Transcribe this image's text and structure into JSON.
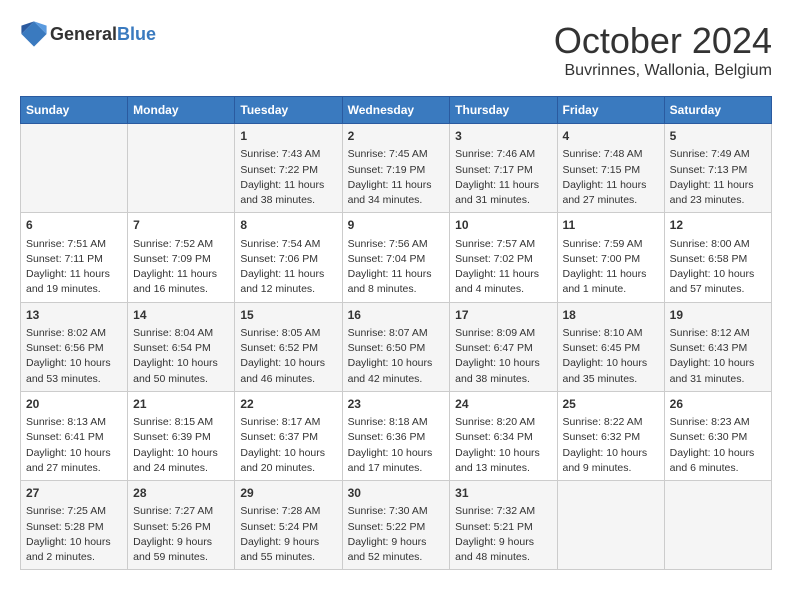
{
  "header": {
    "logo_general": "General",
    "logo_blue": "Blue",
    "month": "October 2024",
    "location": "Buvrinnes, Wallonia, Belgium"
  },
  "days_of_week": [
    "Sunday",
    "Monday",
    "Tuesday",
    "Wednesday",
    "Thursday",
    "Friday",
    "Saturday"
  ],
  "weeks": [
    [
      {
        "day": "",
        "content": ""
      },
      {
        "day": "",
        "content": ""
      },
      {
        "day": "1",
        "content": "Sunrise: 7:43 AM\nSunset: 7:22 PM\nDaylight: 11 hours and 38 minutes."
      },
      {
        "day": "2",
        "content": "Sunrise: 7:45 AM\nSunset: 7:19 PM\nDaylight: 11 hours and 34 minutes."
      },
      {
        "day": "3",
        "content": "Sunrise: 7:46 AM\nSunset: 7:17 PM\nDaylight: 11 hours and 31 minutes."
      },
      {
        "day": "4",
        "content": "Sunrise: 7:48 AM\nSunset: 7:15 PM\nDaylight: 11 hours and 27 minutes."
      },
      {
        "day": "5",
        "content": "Sunrise: 7:49 AM\nSunset: 7:13 PM\nDaylight: 11 hours and 23 minutes."
      }
    ],
    [
      {
        "day": "6",
        "content": "Sunrise: 7:51 AM\nSunset: 7:11 PM\nDaylight: 11 hours and 19 minutes."
      },
      {
        "day": "7",
        "content": "Sunrise: 7:52 AM\nSunset: 7:09 PM\nDaylight: 11 hours and 16 minutes."
      },
      {
        "day": "8",
        "content": "Sunrise: 7:54 AM\nSunset: 7:06 PM\nDaylight: 11 hours and 12 minutes."
      },
      {
        "day": "9",
        "content": "Sunrise: 7:56 AM\nSunset: 7:04 PM\nDaylight: 11 hours and 8 minutes."
      },
      {
        "day": "10",
        "content": "Sunrise: 7:57 AM\nSunset: 7:02 PM\nDaylight: 11 hours and 4 minutes."
      },
      {
        "day": "11",
        "content": "Sunrise: 7:59 AM\nSunset: 7:00 PM\nDaylight: 11 hours and 1 minute."
      },
      {
        "day": "12",
        "content": "Sunrise: 8:00 AM\nSunset: 6:58 PM\nDaylight: 10 hours and 57 minutes."
      }
    ],
    [
      {
        "day": "13",
        "content": "Sunrise: 8:02 AM\nSunset: 6:56 PM\nDaylight: 10 hours and 53 minutes."
      },
      {
        "day": "14",
        "content": "Sunrise: 8:04 AM\nSunset: 6:54 PM\nDaylight: 10 hours and 50 minutes."
      },
      {
        "day": "15",
        "content": "Sunrise: 8:05 AM\nSunset: 6:52 PM\nDaylight: 10 hours and 46 minutes."
      },
      {
        "day": "16",
        "content": "Sunrise: 8:07 AM\nSunset: 6:50 PM\nDaylight: 10 hours and 42 minutes."
      },
      {
        "day": "17",
        "content": "Sunrise: 8:09 AM\nSunset: 6:47 PM\nDaylight: 10 hours and 38 minutes."
      },
      {
        "day": "18",
        "content": "Sunrise: 8:10 AM\nSunset: 6:45 PM\nDaylight: 10 hours and 35 minutes."
      },
      {
        "day": "19",
        "content": "Sunrise: 8:12 AM\nSunset: 6:43 PM\nDaylight: 10 hours and 31 minutes."
      }
    ],
    [
      {
        "day": "20",
        "content": "Sunrise: 8:13 AM\nSunset: 6:41 PM\nDaylight: 10 hours and 27 minutes."
      },
      {
        "day": "21",
        "content": "Sunrise: 8:15 AM\nSunset: 6:39 PM\nDaylight: 10 hours and 24 minutes."
      },
      {
        "day": "22",
        "content": "Sunrise: 8:17 AM\nSunset: 6:37 PM\nDaylight: 10 hours and 20 minutes."
      },
      {
        "day": "23",
        "content": "Sunrise: 8:18 AM\nSunset: 6:36 PM\nDaylight: 10 hours and 17 minutes."
      },
      {
        "day": "24",
        "content": "Sunrise: 8:20 AM\nSunset: 6:34 PM\nDaylight: 10 hours and 13 minutes."
      },
      {
        "day": "25",
        "content": "Sunrise: 8:22 AM\nSunset: 6:32 PM\nDaylight: 10 hours and 9 minutes."
      },
      {
        "day": "26",
        "content": "Sunrise: 8:23 AM\nSunset: 6:30 PM\nDaylight: 10 hours and 6 minutes."
      }
    ],
    [
      {
        "day": "27",
        "content": "Sunrise: 7:25 AM\nSunset: 5:28 PM\nDaylight: 10 hours and 2 minutes."
      },
      {
        "day": "28",
        "content": "Sunrise: 7:27 AM\nSunset: 5:26 PM\nDaylight: 9 hours and 59 minutes."
      },
      {
        "day": "29",
        "content": "Sunrise: 7:28 AM\nSunset: 5:24 PM\nDaylight: 9 hours and 55 minutes."
      },
      {
        "day": "30",
        "content": "Sunrise: 7:30 AM\nSunset: 5:22 PM\nDaylight: 9 hours and 52 minutes."
      },
      {
        "day": "31",
        "content": "Sunrise: 7:32 AM\nSunset: 5:21 PM\nDaylight: 9 hours and 48 minutes."
      },
      {
        "day": "",
        "content": ""
      },
      {
        "day": "",
        "content": ""
      }
    ]
  ]
}
